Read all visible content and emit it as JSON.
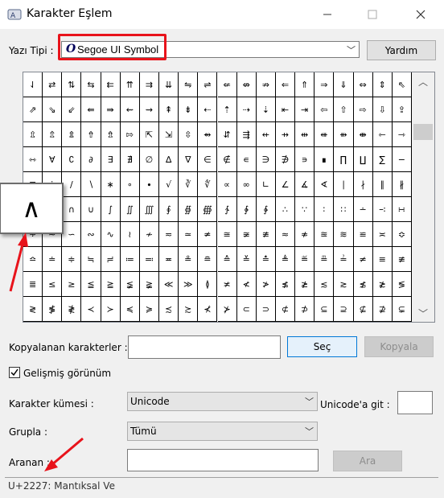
{
  "window": {
    "title": "Karakter Eşlem",
    "minimize_icon": "minimize-icon",
    "maximize_icon": "maximize-icon",
    "close_icon": "close-icon"
  },
  "font": {
    "label": "Yazı Tipi :",
    "value": "Segoe UI Symbol",
    "glyph": "O",
    "help_button": "Yardım"
  },
  "grid": {
    "rows": [
      [
        "⇃",
        "⇄",
        "⇅",
        "⇆",
        "⇇",
        "⇈",
        "⇉",
        "⇊",
        "⇋",
        "⇌",
        "⇍",
        "⇎",
        "⇏",
        "⇐",
        "⇑",
        "⇒",
        "⇓",
        "⇔",
        "⇕",
        "⇖"
      ],
      [
        "⇗",
        "⇘",
        "⇙",
        "⇚",
        "⇛",
        "⇜",
        "⇝",
        "⇞",
        "⇟",
        "⇠",
        "⇡",
        "⇢",
        "⇣",
        "⇤",
        "⇥",
        "⇦",
        "⇧",
        "⇨",
        "⇩",
        "⇪"
      ],
      [
        "⇫",
        "⇬",
        "⇭",
        "⇮",
        "⇯",
        "⇰",
        "⇱",
        "⇲",
        "⇳",
        "⇴",
        "⇵",
        "⇶",
        "⇷",
        "⇸",
        "⇹",
        "⇺",
        "⇻",
        "⇼",
        "⇽",
        "⇾"
      ],
      [
        "⇿",
        "∀",
        "∁",
        "∂",
        "∃",
        "∄",
        "∅",
        "∆",
        "∇",
        "∈",
        "∉",
        "∊",
        "∋",
        "∌",
        "∍",
        "∎",
        "∏",
        "∐",
        "∑",
        "−"
      ],
      [
        "∓",
        "∔",
        "∕",
        "∖",
        "∗",
        "∘",
        "∙",
        "√",
        "∛",
        "∜",
        "∝",
        "∞",
        "∟",
        "∠",
        "∡",
        "∢",
        "∣",
        "∤",
        "∥",
        "∦"
      ],
      [
        "∧",
        "∨",
        "∩",
        "∪",
        "∫",
        "∬",
        "∭",
        "∮",
        "∯",
        "∰",
        "∱",
        "∲",
        "∳",
        "∴",
        "∵",
        "∶",
        "∷",
        "∸",
        "∹",
        "∺"
      ],
      [
        "∻",
        "∼",
        "∽",
        "∾",
        "∿",
        "≀",
        "≁",
        "≂",
        "≃",
        "≄",
        "≅",
        "≆",
        "≇",
        "≈",
        "≉",
        "≊",
        "≋",
        "≌",
        "≍",
        "≎"
      ],
      [
        "≏",
        "≐",
        "≑",
        "≒",
        "≓",
        "≔",
        "≕",
        "≖",
        "≗",
        "≘",
        "≙",
        "≚",
        "≛",
        "≜",
        "≝",
        "≞",
        "≟",
        "≠",
        "≡",
        "≢"
      ],
      [
        "≣",
        "≤",
        "≥",
        "≦",
        "≧",
        "≨",
        "≩",
        "≪",
        "≫",
        "≬",
        "≭",
        "≮",
        "≯",
        "≰",
        "≱",
        "≲",
        "≳",
        "≴",
        "≵",
        "≶"
      ],
      [
        "≷",
        "≸",
        "≹",
        "≺",
        "≻",
        "≼",
        "≽",
        "≾",
        "≿",
        "⊀",
        "⊁",
        "⊂",
        "⊃",
        "⊄",
        "⊅",
        "⊆",
        "⊇",
        "⊈",
        "⊉",
        "⊊"
      ]
    ],
    "zoom_char": "∧",
    "scroll_up_icon": "scroll-up-icon",
    "scroll_down_icon": "scroll-down-icon"
  },
  "copy": {
    "label": "Kopyalanan karakterler :",
    "value": "",
    "select_button": "Seç",
    "copy_button": "Kopyala"
  },
  "advanced": {
    "checked": true,
    "label": "Gelişmiş görünüm"
  },
  "charset": {
    "label": "Karakter kümesi :",
    "value": "Unicode",
    "goto_label": "Unicode'a git :",
    "goto_value": ""
  },
  "group": {
    "label": "Grupla :",
    "value": "Tümü"
  },
  "search": {
    "label": "Aranan :",
    "value": "",
    "button": "Ara"
  },
  "status": {
    "text": "U+2227: Mantıksal Ve"
  },
  "colors": {
    "highlight_red": "#e8131b",
    "accent_blue": "#0078d7"
  }
}
